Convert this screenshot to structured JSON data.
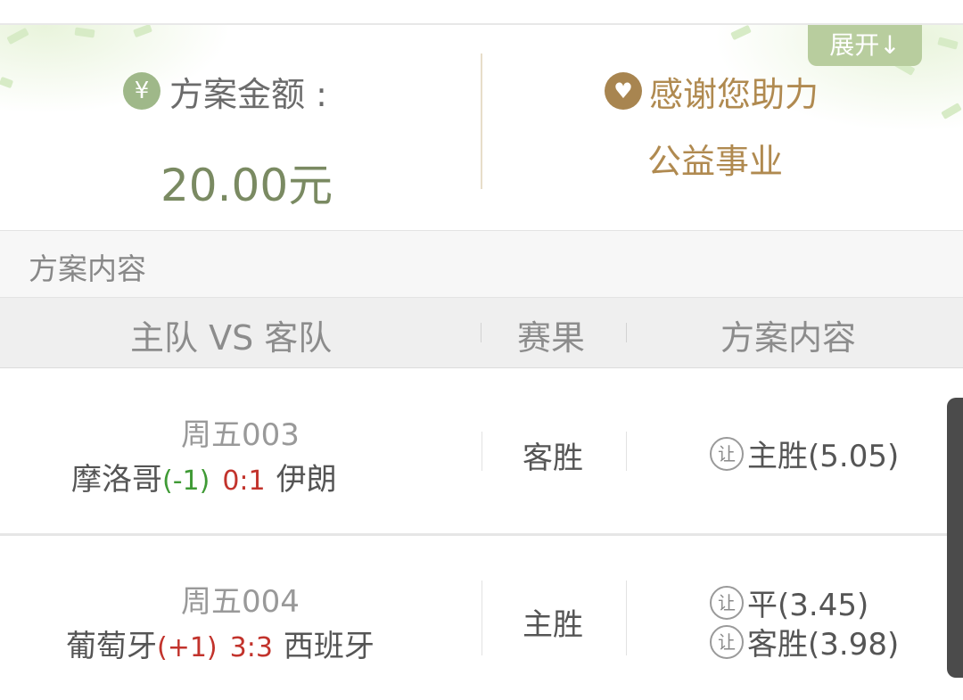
{
  "banner": {
    "expand_label": "展开↓",
    "amount_label": "方案金额 :",
    "amount_value": "20.00元",
    "thanks_line1": "感谢您助力",
    "thanks_line2": "公益事业",
    "yen_icon_char": "¥",
    "heart_icon_char": "♥"
  },
  "section_title": "方案内容",
  "table": {
    "headers": [
      "主队 VS 客队",
      "赛果",
      "方案内容"
    ],
    "rows": [
      {
        "date": "周五003",
        "home": "摩洛哥",
        "handicap": "(-1)",
        "score": "0:1",
        "away": "伊朗",
        "result": "客胜",
        "picks": [
          {
            "badge": "让",
            "text": "主胜(5.05)"
          }
        ]
      },
      {
        "date": "周五004",
        "home": "葡萄牙",
        "handicap": "(+1)",
        "score": "3:3",
        "away": "西班牙",
        "result": "主胜",
        "picks": [
          {
            "badge": "让",
            "text": "平(3.45)"
          },
          {
            "badge": "让",
            "text": "客胜(3.98)"
          }
        ]
      }
    ]
  },
  "colors": {
    "accent_green": "#9fb889",
    "accent_gold": "#b08a50",
    "handicap_green": "#3f9a35",
    "score_red": "#c2332c"
  }
}
